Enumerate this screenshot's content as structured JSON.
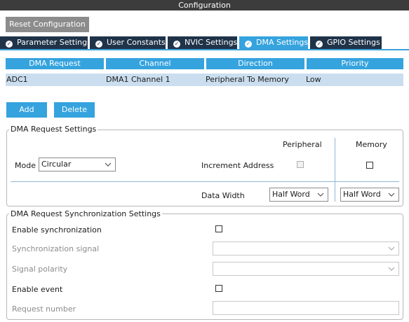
{
  "window": {
    "title": "Configuration"
  },
  "toolbar": {
    "reset_label": "Reset Configuration"
  },
  "tabs": [
    {
      "label": "Parameter Settings",
      "icon": "check-circle-icon"
    },
    {
      "label": "User Constants",
      "icon": "check-circle-icon"
    },
    {
      "label": "NVIC Settings",
      "icon": "check-circle-icon"
    },
    {
      "label": "DMA Settings",
      "icon": "check-circle-icon",
      "active": true
    },
    {
      "label": "GPIO Settings",
      "icon": "check-circle-icon"
    }
  ],
  "dma_table": {
    "headers": [
      "DMA Request",
      "Channel",
      "Direction",
      "Priority"
    ],
    "rows": [
      [
        "ADC1",
        "DMA1 Channel 1",
        "Peripheral To Memory",
        "Low"
      ]
    ]
  },
  "actions": {
    "add_label": "Add",
    "delete_label": "Delete"
  },
  "request_settings": {
    "legend": "DMA Request Settings",
    "peripheral_header": "Peripheral",
    "memory_header": "Memory",
    "mode_label": "Mode",
    "mode_value": "Circular",
    "increment_label": "Increment Address",
    "peripheral_increment": false,
    "memory_increment": false,
    "data_width_label": "Data Width",
    "peripheral_width": "Half Word",
    "memory_width": "Half Word"
  },
  "sync_settings": {
    "legend": "DMA Request Synchronization Settings",
    "enable_sync_label": "Enable synchronization",
    "enable_sync": false,
    "sync_signal_label": "Synchronization signal",
    "sync_signal_value": "",
    "signal_polarity_label": "Signal polarity",
    "signal_polarity_value": "",
    "enable_event_label": "Enable event",
    "enable_event": false,
    "request_number_label": "Request number",
    "request_number_value": ""
  },
  "colors": {
    "title_bg": "#3c3c3c",
    "tab_bg": "#1f3349",
    "accent": "#35a3de",
    "selected_row": "#cadeef",
    "reset_button": "#8c8c8c"
  }
}
